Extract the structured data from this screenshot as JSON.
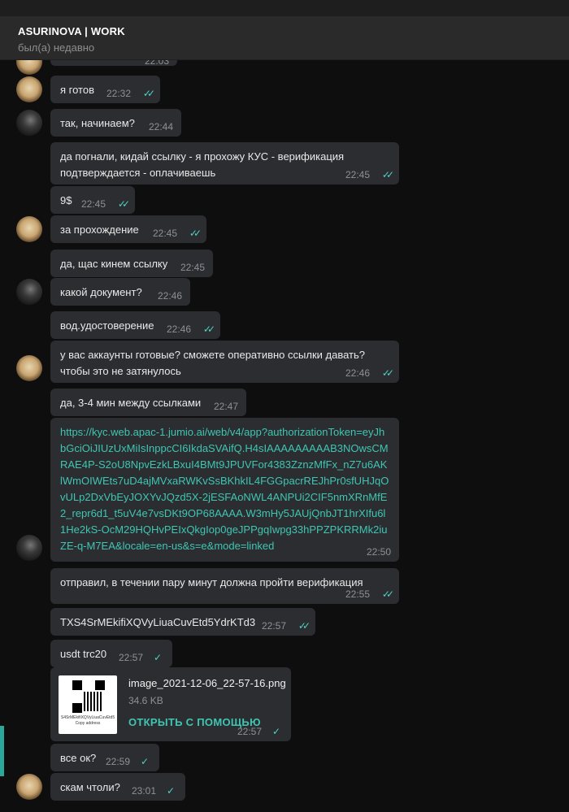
{
  "header": {
    "title": "ASURINOVA | WORK",
    "status": "был(а) недавно"
  },
  "partial_message": {
    "time": "22:03"
  },
  "messages": [
    {
      "text": "я готов",
      "time": "22:32",
      "check": "✓✓"
    },
    {
      "text": "так, начинаем?",
      "time": "22:44"
    },
    {
      "text": "да погнали, кидай ссылку - я прохожу КУС - верификация подтверждается - оплачиваешь",
      "time": "22:45",
      "check": "✓✓"
    },
    {
      "text": "9$",
      "time": "22:45",
      "check": "✓✓"
    },
    {
      "text": "за прохождение",
      "time": "22:45",
      "check": "✓✓"
    },
    {
      "text": "да, щас кинем ссылку",
      "time": "22:45"
    },
    {
      "text": "какой документ?",
      "time": "22:46"
    },
    {
      "text": "вод.удостоверение",
      "time": "22:46",
      "check": "✓✓"
    },
    {
      "text": "у вас аккаунты готовые? сможете оперативно ссылки давать? чтобы это не затянулось",
      "time": "22:46",
      "check": "✓✓"
    },
    {
      "text": "да, 3-4 мин между ссылками",
      "time": "22:47"
    },
    {
      "text": "https://kyc.web.apac-1.jumio.ai/web/v4/app?authorizationToken=eyJhbGciOiJIUzUxMiIsInppcCI6IkdaSVAifQ.H4sIAAAAAAAAAB3NOwsCMRAE4P-S2oU8NpvEzkLBxuI4BMt9JPUVFor4383ZznzMfFx_nZ7u6AKlWmOIWEts7uD4ajMVxaRWKvSsBKhkIL4FGGpacrREJhPr0sfUHJqOvULp2DxVbEyJOXYvJQzd5X-2jESFAoNWL4ANPUi2CIF5nmXRnMfE2_repr6d1_t5uV4e7vsDKt9OP68AAAA.W3mHy5JAUjQnbJT1hrXIfu6l1He2kS-OcM29HQHvPEIxQkgIop0geJPPgqIwpg33hPPZPKRRMk2iuZE-q-M7EA&locale=en-us&s=e&mode=linked",
      "time": "22:50"
    },
    {
      "text": "отправил, в течении пару минут должна пройти верификация",
      "time": "22:55",
      "check": "✓✓"
    },
    {
      "text": "TXS4SrMEkifiXQVyLiuaCuvEtd5YdrKTd3",
      "time": "22:57",
      "check": "✓✓"
    },
    {
      "text": "usdt trc20",
      "time": "22:57",
      "check": "✓"
    },
    {
      "text": "все ок?",
      "time": "22:59",
      "check": "✓"
    },
    {
      "text": "скам чтоли?",
      "time": "23:01",
      "check": "✓"
    }
  ],
  "file": {
    "name": "image_2021-12-06_22-57-16.png",
    "size": "34.6 KB",
    "open_label": "ОТКРЫТЬ С ПОМОЩЬЮ",
    "time": "22:57",
    "check": "✓",
    "thumb_text": "S4SrMEkifiXQVyLiuaCuvEtd5",
    "thumb_copy": "Copy address"
  }
}
